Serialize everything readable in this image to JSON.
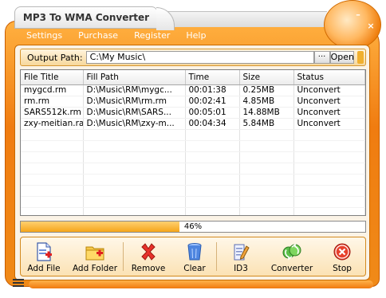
{
  "window": {
    "title": "MP3 To WMA Converter",
    "min_glyph": "–",
    "close_glyph": "×"
  },
  "menu": [
    {
      "label": "Settings"
    },
    {
      "label": "Purchase"
    },
    {
      "label": "Register"
    },
    {
      "label": "Help"
    }
  ],
  "output": {
    "label": "Output Path:",
    "value": "C:\\My Music\\",
    "browse_label": "···",
    "open_label": "Open"
  },
  "table": {
    "columns": [
      "File Title",
      "Fill Path",
      "Time",
      "Size",
      "Status"
    ],
    "rows": [
      [
        "mygcd.rm",
        "D:\\Music\\RM\\mygc...",
        "00:01:38",
        "0.25MB",
        "Unconvert"
      ],
      [
        "rm.rm",
        "D:\\Music\\RM\\rm.rm",
        "00:02:41",
        "4.85MB",
        "Unconvert"
      ],
      [
        "SARS512k.rm",
        "D:\\Music\\RM\\SARS...",
        "00:05:01",
        "14.88MB",
        "Unconvert"
      ],
      [
        "zxy-meitian.ram",
        "D:\\Music\\RM\\zxy-m...",
        "00:04:34",
        "5.84MB",
        "Unconvert"
      ]
    ]
  },
  "progress": {
    "percent": 46,
    "label": "46%"
  },
  "toolbar": [
    {
      "key": "add-file",
      "label": "Add File",
      "icon": "add-file-icon"
    },
    {
      "key": "add-folder",
      "label": "Add Folder",
      "icon": "add-folder-icon"
    },
    {
      "key": "remove",
      "label": "Remove",
      "icon": "remove-icon"
    },
    {
      "key": "clear",
      "label": "Clear",
      "icon": "clear-icon"
    },
    {
      "key": "id3",
      "label": "ID3",
      "icon": "id3-edit-icon"
    },
    {
      "key": "converter",
      "label": "Converter",
      "icon": "converter-icon"
    },
    {
      "key": "stop",
      "label": "Stop",
      "icon": "stop-icon"
    }
  ],
  "colors": {
    "frame": "#f08a18",
    "accent": "#f5a51a",
    "panel": "#fbf3e6"
  }
}
